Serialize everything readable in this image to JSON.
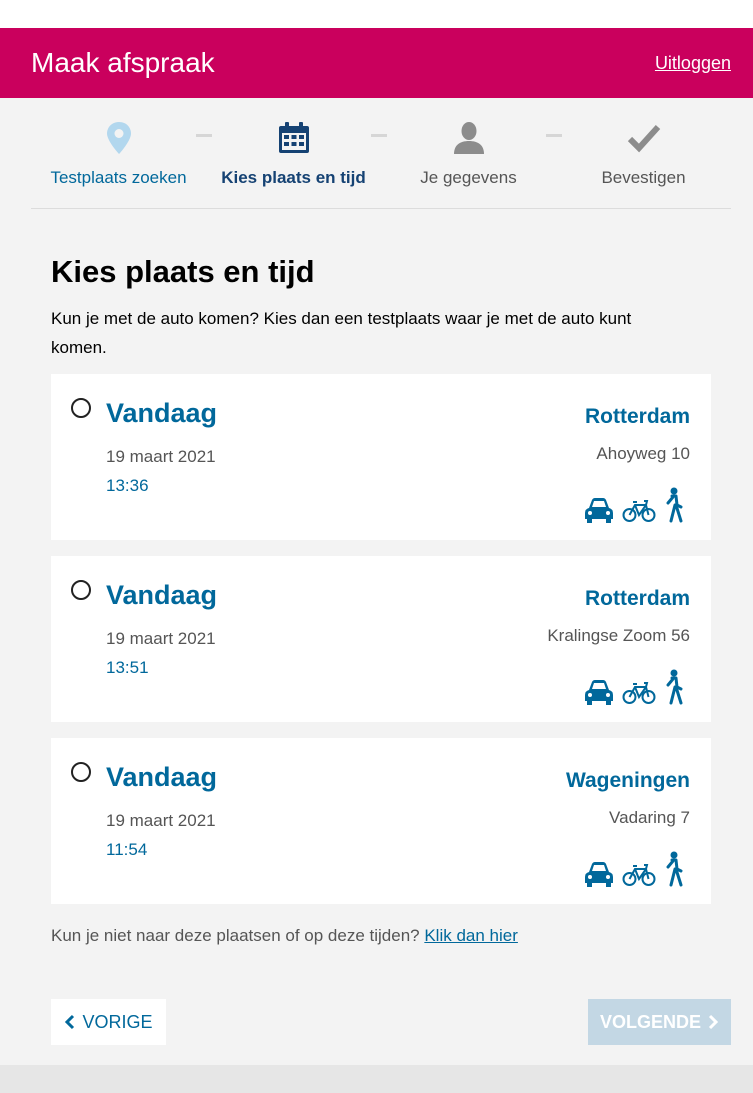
{
  "header": {
    "title": "Maak afspraak",
    "logout_label": "Uitloggen"
  },
  "steps": [
    {
      "label": "Testplaats zoeken",
      "icon": "location-pin-icon",
      "state": "done"
    },
    {
      "label": "Kies plaats en tijd",
      "icon": "calendar-icon",
      "state": "active"
    },
    {
      "label": "Je gegevens",
      "icon": "person-icon",
      "state": "todo"
    },
    {
      "label": "Bevestigen",
      "icon": "checkmark-icon",
      "state": "todo"
    }
  ],
  "page": {
    "title": "Kies plaats en tijd",
    "intro": "Kun je met de auto komen? Kies dan een testplaats waar je met de auto kunt komen."
  },
  "appointments": [
    {
      "day": "Vandaag",
      "date": "19 maart 2021",
      "time": "13:36",
      "city": "Rotterdam",
      "address": "Ahoyweg 10",
      "transport": [
        "car-icon",
        "bicycle-icon",
        "walking-icon"
      ]
    },
    {
      "day": "Vandaag",
      "date": "19 maart 2021",
      "time": "13:51",
      "city": "Rotterdam",
      "address": "Kralingse Zoom 56",
      "transport": [
        "car-icon",
        "bicycle-icon",
        "walking-icon"
      ]
    },
    {
      "day": "Vandaag",
      "date": "19 maart 2021",
      "time": "11:54",
      "city": "Wageningen",
      "address": "Vadaring 7",
      "transport": [
        "car-icon",
        "bicycle-icon",
        "walking-icon"
      ]
    }
  ],
  "other_option": {
    "text": "Kun je niet naar deze plaatsen of op deze tijden?",
    "link": "Klik dan hier"
  },
  "nav": {
    "prev_label": "VORIGE",
    "next_label": "VOLGENDE"
  },
  "colors": {
    "brand": "#ca005d",
    "primary": "#01689b",
    "dark_blue": "#154273",
    "next_disabled": "#c3d7e4"
  }
}
